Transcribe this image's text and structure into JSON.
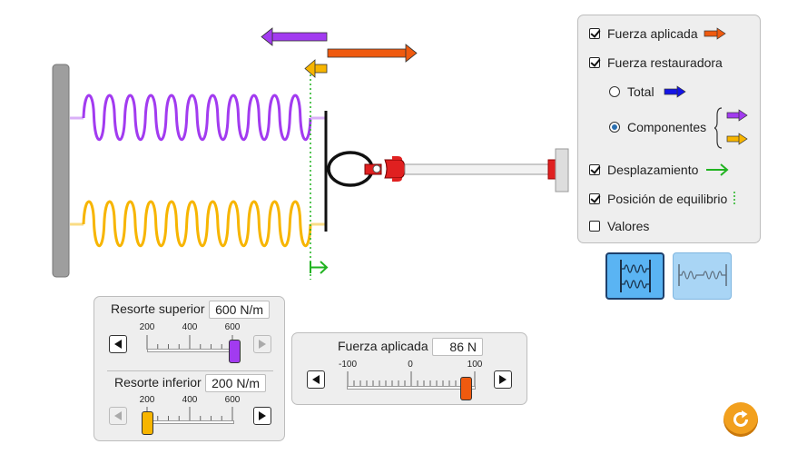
{
  "colors": {
    "purple": "#a23bf0",
    "orange": "#ef5a0f",
    "yellow": "#f7b500",
    "green": "#21b321",
    "blue": "#1414e6",
    "panel_bg": "#eeeeee",
    "view_active_bg": "#5ab4f3",
    "view_inactive_bg": "#a9d5f5",
    "reset_orange": "#f2a01e"
  },
  "scene_icons": {
    "wall": "wall-icon",
    "top_spring": "spring-icon",
    "bottom_spring": "spring-icon",
    "plate": "plate-icon",
    "robot_hand": "robot-hand-icon"
  },
  "options_panel": {
    "applied_force": {
      "label": "Fuerza aplicada",
      "checked": true
    },
    "restoring_force": {
      "label": "Fuerza restauradora",
      "checked": true
    },
    "total": {
      "label": "Total",
      "selected": false
    },
    "components": {
      "label": "Componentes",
      "selected": true
    },
    "displacement": {
      "label": "Desplazamiento",
      "checked": true
    },
    "equilibrium": {
      "label": "Posición de equilibrio",
      "checked": true
    },
    "values": {
      "label": "Valores",
      "checked": false
    }
  },
  "view_buttons": {
    "parallel": {
      "selected": true,
      "icon": "parallel-springs-icon"
    },
    "series": {
      "selected": false,
      "icon": "series-springs-icon"
    }
  },
  "spring_panel": {
    "top": {
      "title": "Resorte superior",
      "value": "600 N/m",
      "ticks": [
        "200",
        "400",
        "600"
      ],
      "min": 200,
      "max": 600,
      "current": 600
    },
    "bottom": {
      "title": "Resorte inferior",
      "value": "200 N/m",
      "ticks": [
        "200",
        "400",
        "600"
      ],
      "min": 200,
      "max": 600,
      "current": 200
    }
  },
  "force_panel": {
    "title": "Fuerza aplicada",
    "value": "86 N",
    "ticks": [
      "-100",
      "0",
      "100"
    ],
    "min": -100,
    "max": 100,
    "current": 86
  },
  "reset": {
    "icon": "reset-icon"
  }
}
